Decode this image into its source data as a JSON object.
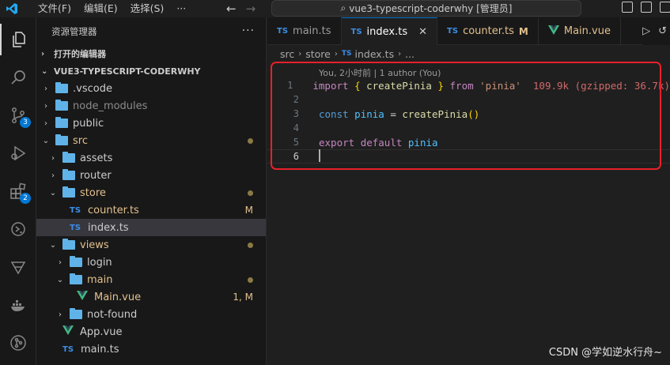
{
  "titlebar": {
    "menu": [
      "文件(F)",
      "编辑(E)",
      "选择(S)",
      "···"
    ],
    "command_center": "vue3-typescript-coderwhy [管理员]"
  },
  "activitybar": {
    "items": [
      {
        "name": "explorer-icon"
      },
      {
        "name": "search-icon"
      },
      {
        "name": "source-control-icon",
        "badge": "3"
      },
      {
        "name": "run-debug-icon"
      },
      {
        "name": "extensions-icon",
        "badge": "2"
      },
      {
        "name": "remote-icon"
      },
      {
        "name": "gitlens-icon"
      },
      {
        "name": "docker-icon"
      },
      {
        "name": "git-graph-icon"
      }
    ]
  },
  "sidebar": {
    "title": "资源管理器",
    "more": "···",
    "open_editors": "打开的编辑器",
    "project": "VUE3-TYPESCRIPT-CODERWHY",
    "tree": [
      {
        "label": ".vscode",
        "type": "folder",
        "depth": 0,
        "open": false
      },
      {
        "label": "node_modules",
        "type": "folder",
        "depth": 0,
        "open": false,
        "dim": true
      },
      {
        "label": "public",
        "type": "folder",
        "depth": 0,
        "open": false
      },
      {
        "label": "src",
        "type": "folder",
        "depth": 0,
        "open": true,
        "modified": true,
        "dot": true
      },
      {
        "label": "assets",
        "type": "folder",
        "depth": 1,
        "open": false
      },
      {
        "label": "router",
        "type": "folder",
        "depth": 1,
        "open": false
      },
      {
        "label": "store",
        "type": "folder",
        "depth": 1,
        "open": true,
        "modified": true,
        "dot": true
      },
      {
        "label": "counter.ts",
        "type": "ts",
        "depth": 2,
        "modified": true,
        "status": "M"
      },
      {
        "label": "index.ts",
        "type": "ts",
        "depth": 2,
        "selected": true
      },
      {
        "label": "views",
        "type": "folder",
        "depth": 1,
        "open": true,
        "modified": true,
        "dot": true
      },
      {
        "label": "login",
        "type": "folder",
        "depth": 2,
        "open": false
      },
      {
        "label": "main",
        "type": "folder",
        "depth": 2,
        "open": true,
        "modified": true,
        "dot": true
      },
      {
        "label": "Main.vue",
        "type": "vue",
        "depth": 3,
        "modified": true,
        "status": "1, M"
      },
      {
        "label": "not-found",
        "type": "folder",
        "depth": 2,
        "open": false
      },
      {
        "label": "App.vue",
        "type": "vue",
        "depth": 1
      },
      {
        "label": "main.ts",
        "type": "ts",
        "depth": 1
      }
    ]
  },
  "tabs": [
    {
      "label": "main.ts",
      "type": "ts"
    },
    {
      "label": "index.ts",
      "type": "ts",
      "active": true,
      "close": "✕"
    },
    {
      "label": "counter.ts",
      "type": "ts",
      "modified": true,
      "status": "M"
    },
    {
      "label": "Main.vue",
      "type": "vue",
      "modified": true
    }
  ],
  "breadcrumb": [
    "src",
    "store",
    "index.ts",
    "..."
  ],
  "blame": "You, 2小时前 | 1 author (You)",
  "code": {
    "line_numbers": [
      "1",
      "2",
      "3",
      "4",
      "5",
      "6"
    ],
    "hint": "109.9k (gzipped: 36.7k)"
  },
  "watermark": "CSDN @学如逆水行舟~",
  "colors": {
    "accent": "#0078d4",
    "highlight_box": "#e8202a",
    "modified": "#e2c08d"
  }
}
